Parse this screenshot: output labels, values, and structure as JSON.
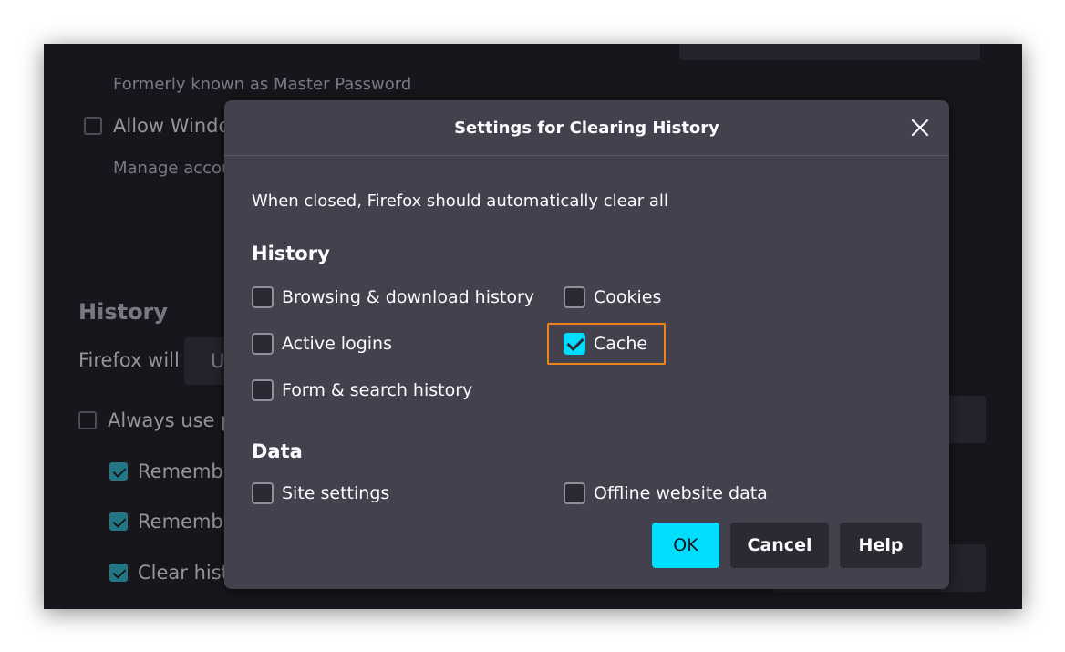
{
  "background": {
    "formerly_text": "Formerly known as Master Password",
    "allow_windows_text": "Allow Windo",
    "manage_accounts_text": "Manage accou",
    "history_heading": "History",
    "firefox_will_text": "Firefox will",
    "dropdown_stub": "U",
    "always_use_text": "Always use p",
    "remember1_text": "Remembe",
    "remember2_text": "Remembe",
    "clear_history_text": "Clear histo"
  },
  "dialog": {
    "title": "Settings for Clearing History",
    "intro": "When closed, Firefox should automatically clear all",
    "history_heading": "History",
    "data_heading": "Data",
    "options": {
      "browsing": {
        "label": "Browsing & download history",
        "checked": false
      },
      "cookies": {
        "label": "Cookies",
        "checked": false
      },
      "active_logins": {
        "label": "Active logins",
        "checked": false
      },
      "cache": {
        "label": "Cache",
        "checked": true
      },
      "form_search": {
        "label": "Form & search history",
        "checked": false
      },
      "site_settings": {
        "label": "Site settings",
        "checked": false
      },
      "offline_data": {
        "label": "Offline website data",
        "checked": false
      }
    },
    "buttons": {
      "ok": "OK",
      "cancel": "Cancel",
      "help": "Help"
    }
  },
  "colors": {
    "accent": "#00ddff",
    "highlight": "#f0821e",
    "dialog_bg": "#42414d",
    "page_bg": "#1c1b22"
  },
  "icons": {
    "close": "close-icon",
    "check": "checkmark-icon"
  }
}
